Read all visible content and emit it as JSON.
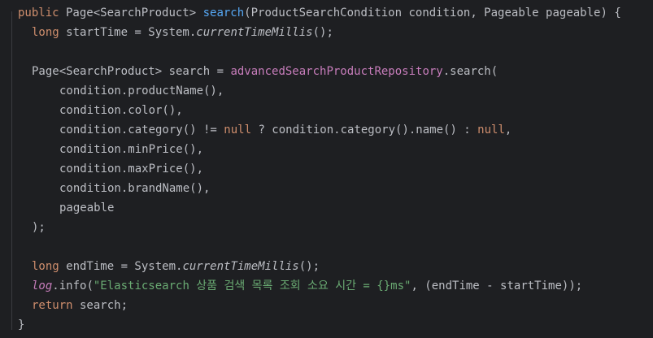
{
  "code": {
    "l1": {
      "kw": "public",
      "t1": " Page<SearchProduct> ",
      "fn": "search",
      "t2": "(ProductSearchCondition condition, Pageable pageable) {"
    },
    "l2": {
      "kw": "long",
      "t1": " startTime = System.",
      "m": "currentTimeMillis",
      "t2": "();"
    },
    "l3": {
      "t1": "Page<SearchProduct> search = ",
      "field": "advancedSearchProductRepository",
      "t2": ".search("
    },
    "l4": {
      "t1": "condition.productName(),"
    },
    "l5": {
      "t1": "condition.color(),"
    },
    "l6": {
      "t1": "condition.category() != ",
      "kw1": "null",
      "t2": " ? condition.category().name() : ",
      "kw2": "null",
      "t3": ","
    },
    "l7": {
      "t1": "condition.minPrice(),"
    },
    "l8": {
      "t1": "condition.maxPrice(),"
    },
    "l9": {
      "t1": "condition.brandName(),"
    },
    "l10": {
      "t1": "pageable"
    },
    "l11": {
      "t1": ");"
    },
    "l12": {
      "kw": "long",
      "t1": " endTime = System.",
      "m": "currentTimeMillis",
      "t2": "();"
    },
    "l13": {
      "logv": "log",
      "t1": ".info(",
      "str": "\"Elasticsearch 상품 검색 목록 조회 소요 시간 = {}ms\"",
      "t2": ", (endTime - startTime));"
    },
    "l14": {
      "kw": "return",
      "t1": " search;"
    },
    "l15": {
      "t1": "}"
    }
  },
  "colors": {
    "background": "#1e1f22",
    "text": "#bcbec4",
    "keyword": "#cf8e6d",
    "method": "#56a8f5",
    "field": "#c77dbb",
    "string": "#6aab73"
  }
}
